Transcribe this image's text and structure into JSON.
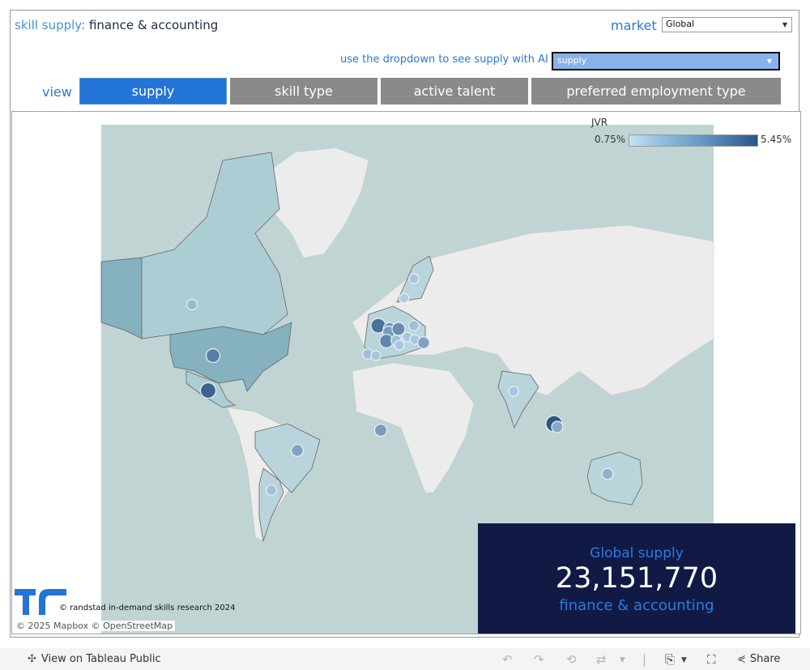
{
  "header": {
    "title_prefix": "skill supply:",
    "title_main": "finance & accounting",
    "market_label": "market",
    "market_value": "Global",
    "ai_label": "use the dropdown to see supply with AI",
    "ai_value": "supply",
    "view_label": "view"
  },
  "tabs": [
    {
      "label": "supply",
      "active": true
    },
    {
      "label": "skill type",
      "active": false
    },
    {
      "label": "active talent",
      "active": false
    },
    {
      "label": "preferred employment type",
      "active": false
    }
  ],
  "legend": {
    "title": "JVR",
    "min": "0.75%",
    "max": "5.45%",
    "colors": [
      "#c6e2f4",
      "#2c5584"
    ]
  },
  "map": {
    "markers": [
      {
        "name": "canada",
        "level": 0.3
      },
      {
        "name": "united-states",
        "level": 0.7
      },
      {
        "name": "mexico",
        "level": 0.9
      },
      {
        "name": "brazil",
        "level": 0.45
      },
      {
        "name": "argentina",
        "level": 0.25
      },
      {
        "name": "sweden",
        "level": 0.2
      },
      {
        "name": "norway",
        "level": 0.15
      },
      {
        "name": "united-kingdom",
        "level": 0.8
      },
      {
        "name": "netherlands",
        "level": 0.55
      },
      {
        "name": "belgium",
        "level": 0.5
      },
      {
        "name": "germany",
        "level": 0.6
      },
      {
        "name": "poland",
        "level": 0.25
      },
      {
        "name": "france",
        "level": 0.65
      },
      {
        "name": "switzerland",
        "level": 0.25
      },
      {
        "name": "austria",
        "level": 0.2
      },
      {
        "name": "italy",
        "level": 0.2
      },
      {
        "name": "hungary",
        "level": 0.2
      },
      {
        "name": "romania",
        "level": 0.45
      },
      {
        "name": "spain",
        "level": 0.25
      },
      {
        "name": "portugal",
        "level": 0.2
      },
      {
        "name": "india",
        "level": 0.2
      },
      {
        "name": "singapore",
        "level": 1.0
      },
      {
        "name": "malaysia",
        "level": 0.4
      },
      {
        "name": "australia",
        "level": 0.35
      },
      {
        "name": "ghana-offshore",
        "level": 0.5
      }
    ],
    "copyright": "© randstad in-demand skills research 2024",
    "attribution": "© 2025 Mapbox  © OpenStreetMap"
  },
  "kpi": {
    "label": "Global supply",
    "value": "23,151,770",
    "sub": "finance & accounting"
  },
  "toolbar": {
    "tableau_link": "View on Tableau Public",
    "share_label": "Share"
  }
}
